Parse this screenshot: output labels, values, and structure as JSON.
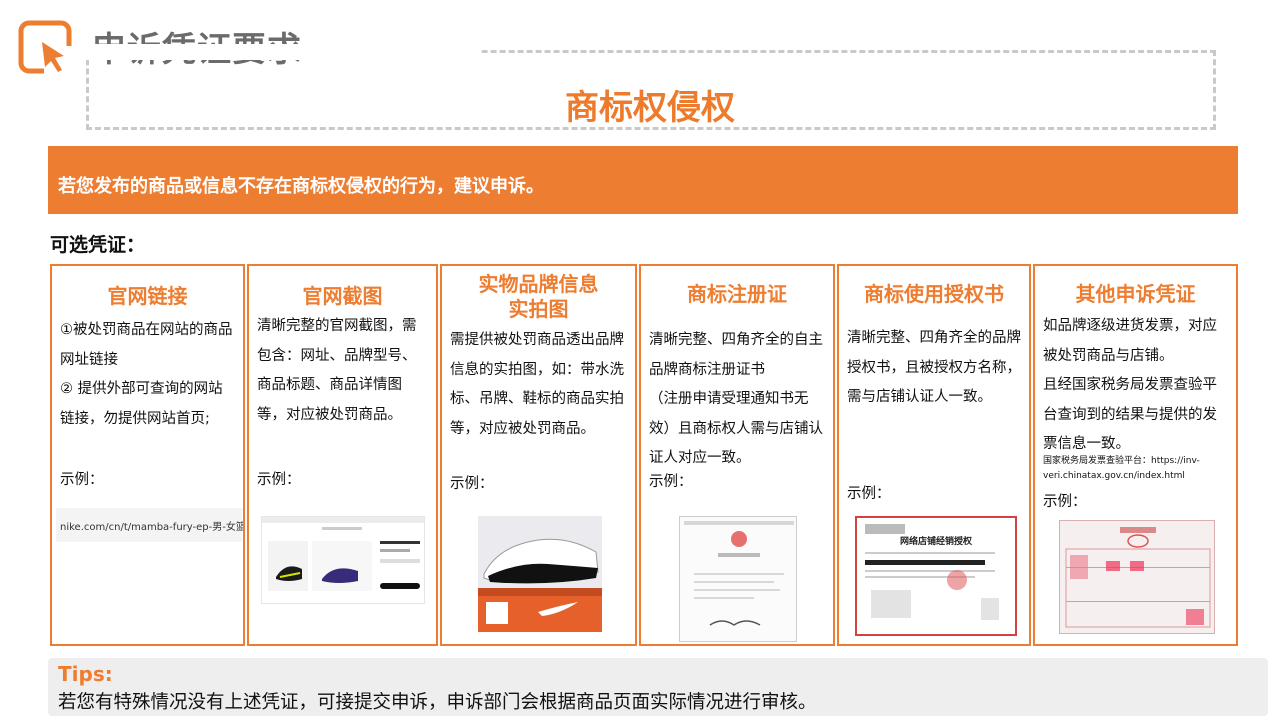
{
  "header": {
    "title": "申诉凭证要求",
    "subtitle": "商标权侵权"
  },
  "banner": {
    "text": "若您发布的商品或信息不存在商标权侵权的行为，建议申诉。"
  },
  "optional_label": "可选凭证：",
  "cards": [
    {
      "title": "官网链接",
      "body": [
        "①被处罚商品在网站的商品网址链接",
        "② 提供外部可查询的网站链接，勿提供网站首页;"
      ],
      "example": "示例：",
      "url": "nike.com/cn/t/mamba-fury-ep-男-女篮球鞋-"
    },
    {
      "title": "官网截图",
      "body": [
        "清晰完整的官网截图，需包含：网址、品牌型号、商品标题、商品详情图等，对应被处罚商品。"
      ],
      "example": "示例："
    },
    {
      "title_line1": "实物品牌信息",
      "title_line2": "实拍图",
      "body": [
        "需提供被处罚商品透出品牌信息的实拍图，如：带水洗标、吊牌、鞋标的商品实拍等，对应被处罚商品。"
      ],
      "example": "示例："
    },
    {
      "title": "商标注册证",
      "body": [
        "清晰完整、四角齐全的自主品牌商标注册证书",
        "（注册申请受理通知书无效）且商标权人需与店铺认证人对应一致。"
      ],
      "example": "示例："
    },
    {
      "title": "商标使用授权书",
      "body": [
        "清晰完整、四角齐全的品牌授权书，且被授权方名称，需与店铺认证人一致。"
      ],
      "example": "示例：",
      "image_text": "网络店铺经销授权"
    },
    {
      "title": "其他申诉凭证",
      "body": [
        "如品牌逐级进货发票，对应被处罚商品与店铺。",
        "且经国家税务局发票查验平台查询到的结果与提供的发票信息一致。"
      ],
      "note": "国家税务局发票查验平台：https://inv-veri.chinatax.gov.cn/index.html",
      "example": "示例："
    }
  ],
  "tips": {
    "label": "Tips:",
    "text": "若您有特殊情况没有上述凭证，可接提交申诉，申诉部门会根据商品页面实际情况进行审核。"
  },
  "colors": {
    "accent": "#ed7d31",
    "title_gray": "#6b6b6b",
    "tips_bg": "#eeeeee"
  }
}
